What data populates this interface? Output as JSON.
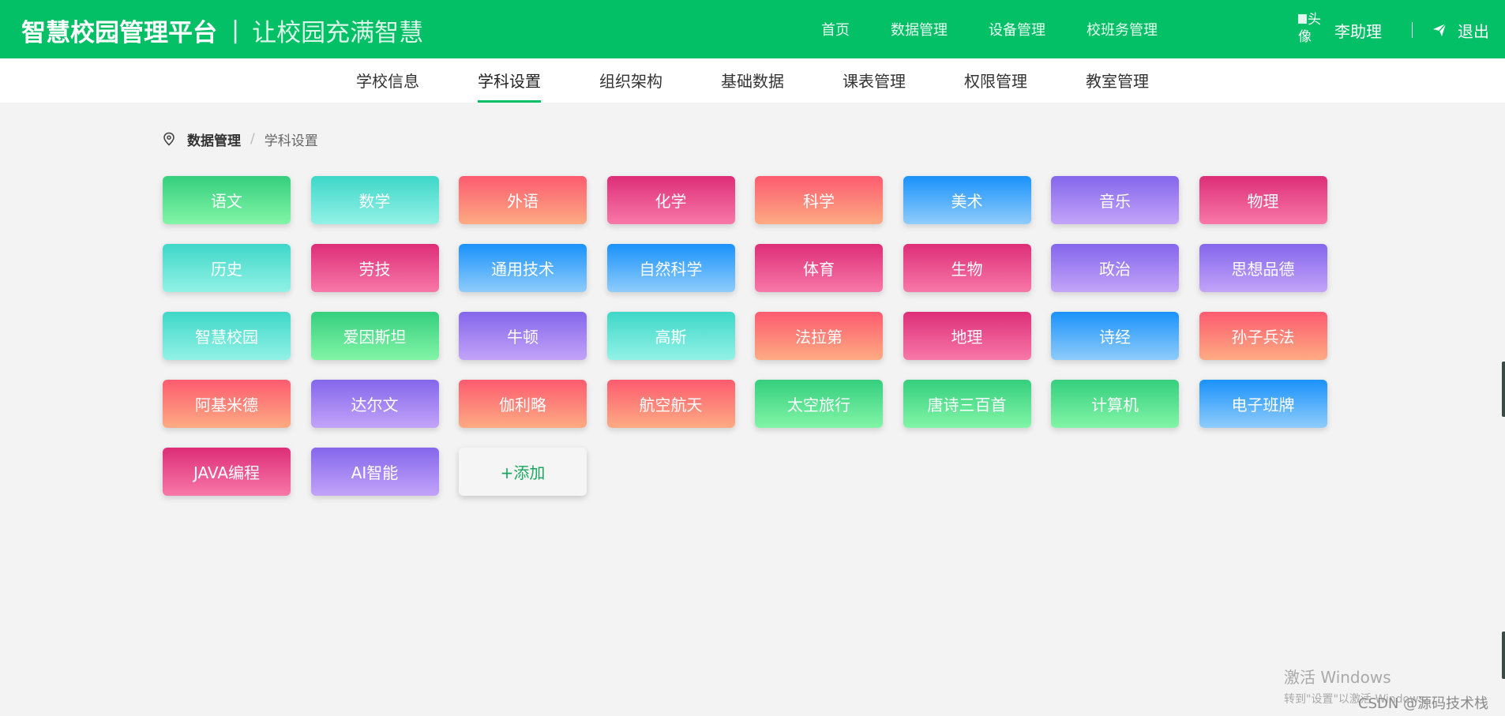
{
  "header": {
    "title": "智慧校园管理平台",
    "separator": "|",
    "slogan": "让校园充满智慧",
    "nav": [
      "首页",
      "数据管理",
      "设备管理",
      "校班务管理"
    ],
    "avatar_alt_1": "头",
    "avatar_alt_2": "像",
    "user_name": "李助理",
    "user_separator": "|",
    "logout": "退出"
  },
  "subnav": {
    "items": [
      "学校信息",
      "学科设置",
      "组织架构",
      "基础数据",
      "课表管理",
      "权限管理",
      "教室管理"
    ],
    "active_index": 1
  },
  "breadcrumb": {
    "root": "数据管理",
    "separator": "/",
    "current": "学科设置"
  },
  "subjects": [
    {
      "label": "语文",
      "color": "green"
    },
    {
      "label": "数学",
      "color": "cyan"
    },
    {
      "label": "外语",
      "color": "coral"
    },
    {
      "label": "化学",
      "color": "rose"
    },
    {
      "label": "科学",
      "color": "coral"
    },
    {
      "label": "美术",
      "color": "blue"
    },
    {
      "label": "音乐",
      "color": "purple"
    },
    {
      "label": "物理",
      "color": "rose"
    },
    {
      "label": "历史",
      "color": "cyan"
    },
    {
      "label": "劳技",
      "color": "rose"
    },
    {
      "label": "通用技术",
      "color": "blue"
    },
    {
      "label": "自然科学",
      "color": "blue"
    },
    {
      "label": "体育",
      "color": "rose"
    },
    {
      "label": "生物",
      "color": "rose"
    },
    {
      "label": "政治",
      "color": "purple"
    },
    {
      "label": "思想品德",
      "color": "purple"
    },
    {
      "label": "智慧校园",
      "color": "cyan"
    },
    {
      "label": "爱因斯坦",
      "color": "green"
    },
    {
      "label": "牛顿",
      "color": "purple"
    },
    {
      "label": "高斯",
      "color": "cyan"
    },
    {
      "label": "法拉第",
      "color": "coral"
    },
    {
      "label": "地理",
      "color": "rose"
    },
    {
      "label": "诗经",
      "color": "blue"
    },
    {
      "label": "孙子兵法",
      "color": "coral"
    },
    {
      "label": "阿基米德",
      "color": "coral"
    },
    {
      "label": "达尔文",
      "color": "purple"
    },
    {
      "label": "伽利略",
      "color": "coral"
    },
    {
      "label": "航空航天",
      "color": "coral"
    },
    {
      "label": "太空旅行",
      "color": "green"
    },
    {
      "label": "唐诗三百首",
      "color": "green"
    },
    {
      "label": "计算机",
      "color": "green"
    },
    {
      "label": "电子班牌",
      "color": "blue"
    },
    {
      "label": "JAVA编程",
      "color": "rose"
    },
    {
      "label": "AI智能",
      "color": "purple"
    }
  ],
  "add_button": "+添加",
  "colors": {
    "brand": "#03bf66",
    "green": "#34cf7e",
    "cyan": "#3ed7c8",
    "coral": "#fd5b6f",
    "rose": "#dd2e78",
    "blue": "#1a92fb",
    "purple": "#8466ec"
  },
  "icons": {
    "location": "map-pin-icon",
    "send": "paper-plane-icon"
  },
  "watermark": {
    "windows_line1": "激活 Windows",
    "windows_line2": "转到\"设置\"以激活 Windows。",
    "csdn": "CSDN @源码技术栈"
  }
}
